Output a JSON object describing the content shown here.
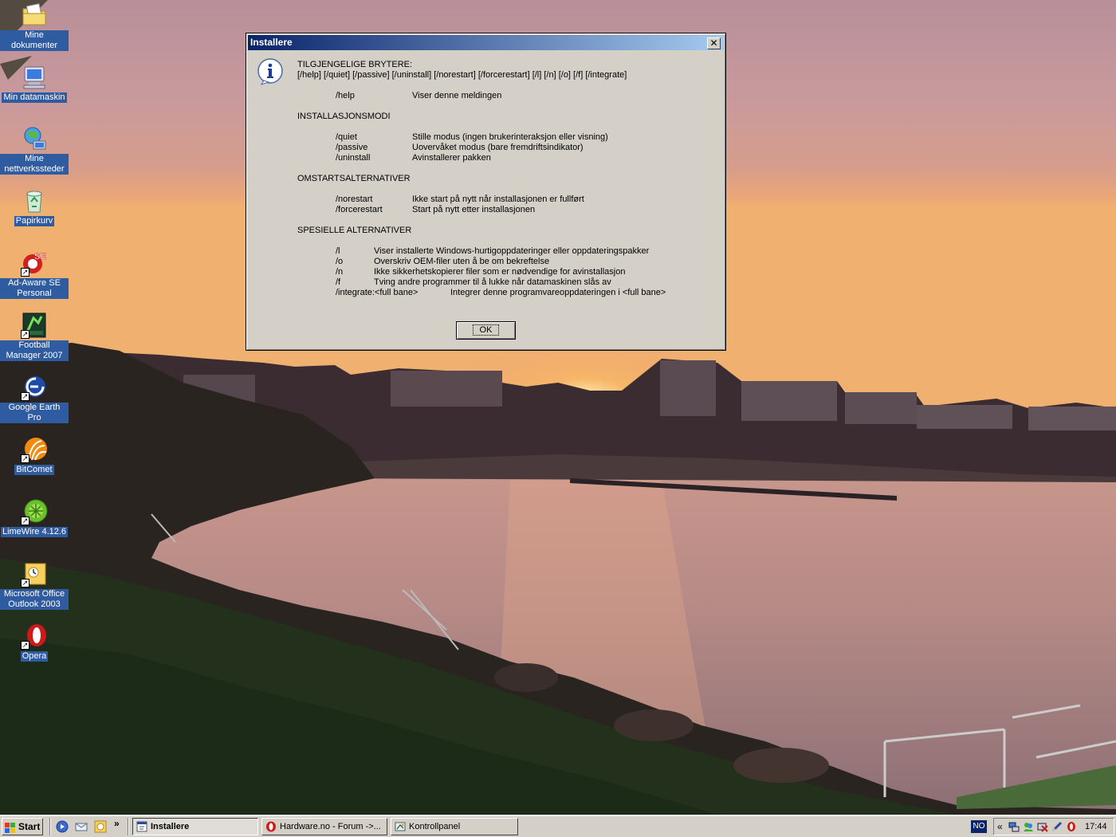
{
  "dialog": {
    "title": "Installere",
    "header1": "TILGJENGELIGE BRYTERE:",
    "header2": "[/help] [/quiet] [/passive] [/uninstall] [/norestart] [/forcerestart] [/l] [/n] [/o] [/f] [/integrate]",
    "help": {
      "switch": "/help",
      "desc": "Viser denne meldingen"
    },
    "section_install": "INSTALLASJONSMODI",
    "install_rows": [
      {
        "switch": "/quiet",
        "desc": "Stille modus (ingen brukerinteraksjon eller visning)"
      },
      {
        "switch": "/passive",
        "desc": "Uovervåket modus (bare fremdriftsindikator)"
      },
      {
        "switch": "/uninstall",
        "desc": "Avinstallerer pakken"
      }
    ],
    "section_restart": "OMSTARTSALTERNATIVER",
    "restart_rows": [
      {
        "switch": "/norestart",
        "desc": "Ikke start på nytt når installasjonen er fullført"
      },
      {
        "switch": "/forcerestart",
        "desc": "Start på nytt etter installasjonen"
      }
    ],
    "section_special": "SPESIELLE ALTERNATIVER",
    "special_rows": [
      {
        "switch": "/l",
        "desc": "Viser installerte Windows-hurtigoppdateringer eller oppdateringspakker"
      },
      {
        "switch": "/o",
        "desc": "Overskriv OEM-filer uten å be om bekreftelse"
      },
      {
        "switch": "/n",
        "desc": "Ikke sikkerhetskopierer filer som er nødvendige for avinstallasjon"
      },
      {
        "switch": "/f",
        "desc": "Tving andre programmer til å lukke når datamaskinen slås av"
      }
    ],
    "integrate": {
      "switch": "/integrate:<full bane>",
      "desc": "Integrer denne programvareoppdateringen i <full bane>"
    },
    "ok_label": "OK",
    "close_glyph": "✕"
  },
  "desktop_icons": [
    {
      "label": "Mine dokumenter",
      "icon": "folder-documents-icon"
    },
    {
      "label": "Min datamaskin",
      "icon": "computer-icon"
    },
    {
      "label": "Mine nettverkssteder",
      "icon": "network-icon"
    },
    {
      "label": "Papirkurv",
      "icon": "recycle-bin-icon"
    },
    {
      "label": "Ad-Aware SE Personal",
      "icon": "adaware-icon"
    },
    {
      "label": "Football Manager 2007",
      "icon": "football-manager-icon"
    },
    {
      "label": "Google Earth Pro",
      "icon": "google-earth-icon"
    },
    {
      "label": "BitComet",
      "icon": "bitcomet-icon"
    },
    {
      "label": "LimeWire 4.12.6",
      "icon": "limewire-icon"
    },
    {
      "label": "Microsoft Office Outlook 2003",
      "icon": "outlook-icon"
    },
    {
      "label": "Opera",
      "icon": "opera-icon"
    }
  ],
  "taskbar": {
    "start_label": "Start",
    "quicklaunch_more": "»",
    "tasks": [
      {
        "label": "Installere",
        "active": true
      },
      {
        "label": "Hardware.no - Forum ->...",
        "active": false
      },
      {
        "label": "Kontrollpanel",
        "active": false
      }
    ],
    "language": "NO",
    "tray_chevron": "«",
    "clock": "17:44"
  }
}
